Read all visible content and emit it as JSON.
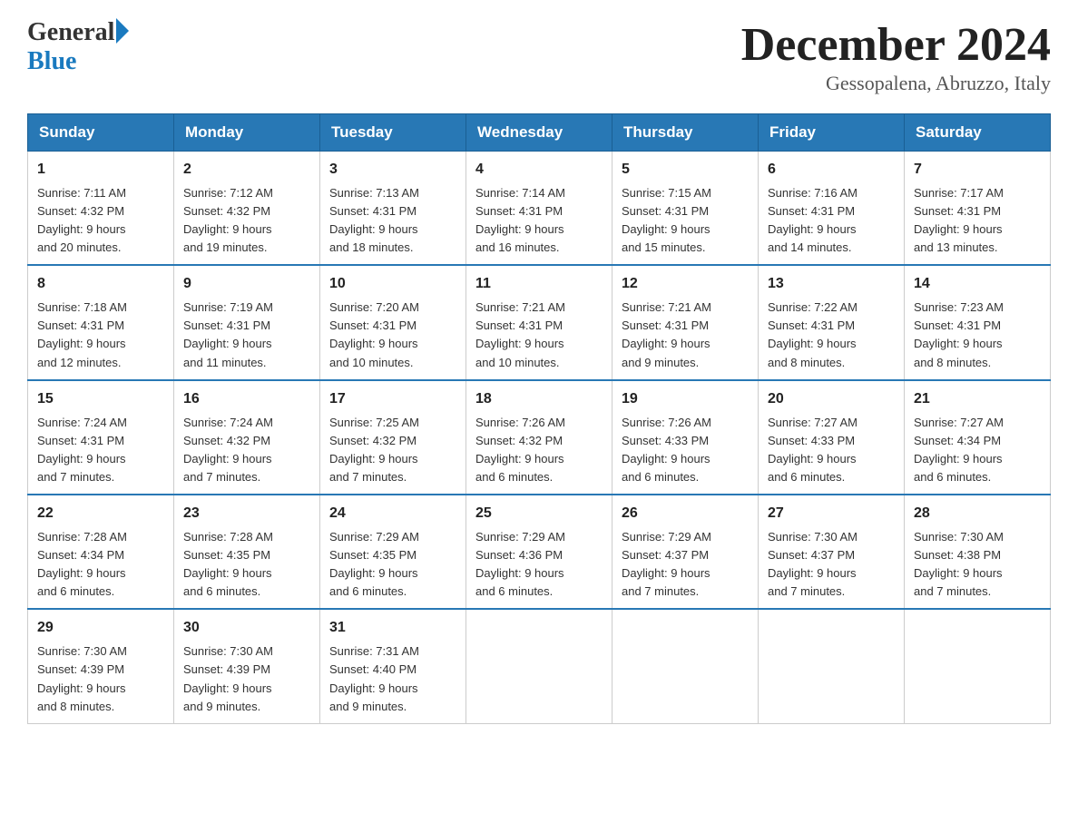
{
  "header": {
    "logo_general": "General",
    "logo_blue": "Blue",
    "month_title": "December 2024",
    "location": "Gessopalena, Abruzzo, Italy"
  },
  "days_of_week": [
    "Sunday",
    "Monday",
    "Tuesday",
    "Wednesday",
    "Thursday",
    "Friday",
    "Saturday"
  ],
  "weeks": [
    [
      {
        "day": "1",
        "sunrise": "7:11 AM",
        "sunset": "4:32 PM",
        "daylight": "9 hours and 20 minutes."
      },
      {
        "day": "2",
        "sunrise": "7:12 AM",
        "sunset": "4:32 PM",
        "daylight": "9 hours and 19 minutes."
      },
      {
        "day": "3",
        "sunrise": "7:13 AM",
        "sunset": "4:31 PM",
        "daylight": "9 hours and 18 minutes."
      },
      {
        "day": "4",
        "sunrise": "7:14 AM",
        "sunset": "4:31 PM",
        "daylight": "9 hours and 16 minutes."
      },
      {
        "day": "5",
        "sunrise": "7:15 AM",
        "sunset": "4:31 PM",
        "daylight": "9 hours and 15 minutes."
      },
      {
        "day": "6",
        "sunrise": "7:16 AM",
        "sunset": "4:31 PM",
        "daylight": "9 hours and 14 minutes."
      },
      {
        "day": "7",
        "sunrise": "7:17 AM",
        "sunset": "4:31 PM",
        "daylight": "9 hours and 13 minutes."
      }
    ],
    [
      {
        "day": "8",
        "sunrise": "7:18 AM",
        "sunset": "4:31 PM",
        "daylight": "9 hours and 12 minutes."
      },
      {
        "day": "9",
        "sunrise": "7:19 AM",
        "sunset": "4:31 PM",
        "daylight": "9 hours and 11 minutes."
      },
      {
        "day": "10",
        "sunrise": "7:20 AM",
        "sunset": "4:31 PM",
        "daylight": "9 hours and 10 minutes."
      },
      {
        "day": "11",
        "sunrise": "7:21 AM",
        "sunset": "4:31 PM",
        "daylight": "9 hours and 10 minutes."
      },
      {
        "day": "12",
        "sunrise": "7:21 AM",
        "sunset": "4:31 PM",
        "daylight": "9 hours and 9 minutes."
      },
      {
        "day": "13",
        "sunrise": "7:22 AM",
        "sunset": "4:31 PM",
        "daylight": "9 hours and 8 minutes."
      },
      {
        "day": "14",
        "sunrise": "7:23 AM",
        "sunset": "4:31 PM",
        "daylight": "9 hours and 8 minutes."
      }
    ],
    [
      {
        "day": "15",
        "sunrise": "7:24 AM",
        "sunset": "4:31 PM",
        "daylight": "9 hours and 7 minutes."
      },
      {
        "day": "16",
        "sunrise": "7:24 AM",
        "sunset": "4:32 PM",
        "daylight": "9 hours and 7 minutes."
      },
      {
        "day": "17",
        "sunrise": "7:25 AM",
        "sunset": "4:32 PM",
        "daylight": "9 hours and 7 minutes."
      },
      {
        "day": "18",
        "sunrise": "7:26 AM",
        "sunset": "4:32 PM",
        "daylight": "9 hours and 6 minutes."
      },
      {
        "day": "19",
        "sunrise": "7:26 AM",
        "sunset": "4:33 PM",
        "daylight": "9 hours and 6 minutes."
      },
      {
        "day": "20",
        "sunrise": "7:27 AM",
        "sunset": "4:33 PM",
        "daylight": "9 hours and 6 minutes."
      },
      {
        "day": "21",
        "sunrise": "7:27 AM",
        "sunset": "4:34 PM",
        "daylight": "9 hours and 6 minutes."
      }
    ],
    [
      {
        "day": "22",
        "sunrise": "7:28 AM",
        "sunset": "4:34 PM",
        "daylight": "9 hours and 6 minutes."
      },
      {
        "day": "23",
        "sunrise": "7:28 AM",
        "sunset": "4:35 PM",
        "daylight": "9 hours and 6 minutes."
      },
      {
        "day": "24",
        "sunrise": "7:29 AM",
        "sunset": "4:35 PM",
        "daylight": "9 hours and 6 minutes."
      },
      {
        "day": "25",
        "sunrise": "7:29 AM",
        "sunset": "4:36 PM",
        "daylight": "9 hours and 6 minutes."
      },
      {
        "day": "26",
        "sunrise": "7:29 AM",
        "sunset": "4:37 PM",
        "daylight": "9 hours and 7 minutes."
      },
      {
        "day": "27",
        "sunrise": "7:30 AM",
        "sunset": "4:37 PM",
        "daylight": "9 hours and 7 minutes."
      },
      {
        "day": "28",
        "sunrise": "7:30 AM",
        "sunset": "4:38 PM",
        "daylight": "9 hours and 7 minutes."
      }
    ],
    [
      {
        "day": "29",
        "sunrise": "7:30 AM",
        "sunset": "4:39 PM",
        "daylight": "9 hours and 8 minutes."
      },
      {
        "day": "30",
        "sunrise": "7:30 AM",
        "sunset": "4:39 PM",
        "daylight": "9 hours and 9 minutes."
      },
      {
        "day": "31",
        "sunrise": "7:31 AM",
        "sunset": "4:40 PM",
        "daylight": "9 hours and 9 minutes."
      },
      null,
      null,
      null,
      null
    ]
  ]
}
